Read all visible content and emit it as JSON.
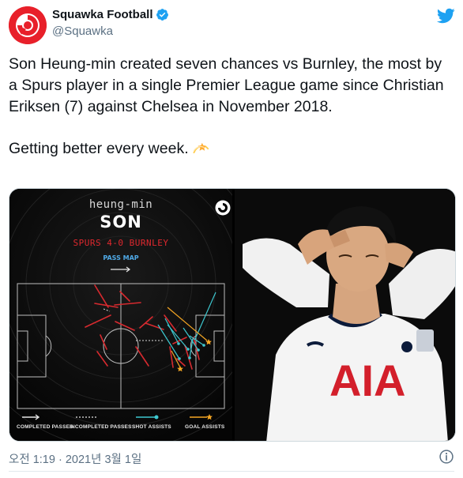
{
  "header": {
    "display_name": "Squawka Football",
    "handle": "@Squawka",
    "avatar_icon": "squawka-logo-icon",
    "verified_icon": "verified-badge-icon",
    "platform_icon": "twitter-bird-icon",
    "brand_color": "#e8202a",
    "twitter_blue": "#1da1f2"
  },
  "tweet": {
    "paragraph_1": "Son Heung-min created seven chances vs Burnley, the most by a Spurs player in a single Premier League game since Christian Eriksen (7) against Chelsea in November 2018.",
    "paragraph_2": "Getting better every week.",
    "emoji_icon": "dizzy-star-emoji-icon"
  },
  "media": {
    "pass_map": {
      "first_name": "heung-min",
      "last_name": "SON",
      "match": "SPURS 4-0 BURNLEY",
      "map_label": "PASS MAP",
      "legend": {
        "completed": "COMPLETED PASSES",
        "incompleted": "INCOMPLETED PASSES",
        "shot_assists": "SHOT ASSISTS",
        "goal_assists": "GOAL ASSISTS"
      },
      "colors": {
        "completed": "#d8d8d8",
        "incompleted": "#d72a2f",
        "shot_assist": "#3dc7cf",
        "goal_assist": "#f5a623",
        "match": "#e0282e"
      }
    },
    "photo": {
      "shirt_sponsor": "AIA"
    }
  },
  "footer": {
    "timestamp": "오전 1:19 · 2021년 3월 1일",
    "info_icon": "info-icon"
  }
}
